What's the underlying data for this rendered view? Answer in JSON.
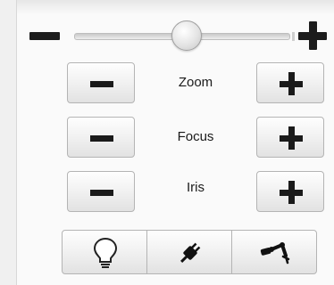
{
  "zoom_slider": {
    "minus_icon": "minus-icon",
    "plus_icon": "plus-icon",
    "level": 0.52
  },
  "controls": [
    {
      "label": "Zoom",
      "decrease_icon": "minus-icon",
      "increase_icon": "plus-icon"
    },
    {
      "label": "Focus",
      "decrease_icon": "minus-icon",
      "increase_icon": "plus-icon"
    },
    {
      "label": "Iris",
      "decrease_icon": "minus-icon",
      "increase_icon": "plus-icon"
    }
  ],
  "toolbar": {
    "buttons": [
      {
        "icon": "light-bulb-icon"
      },
      {
        "icon": "power-plug-icon"
      },
      {
        "icon": "robot-arm-icon"
      }
    ]
  }
}
